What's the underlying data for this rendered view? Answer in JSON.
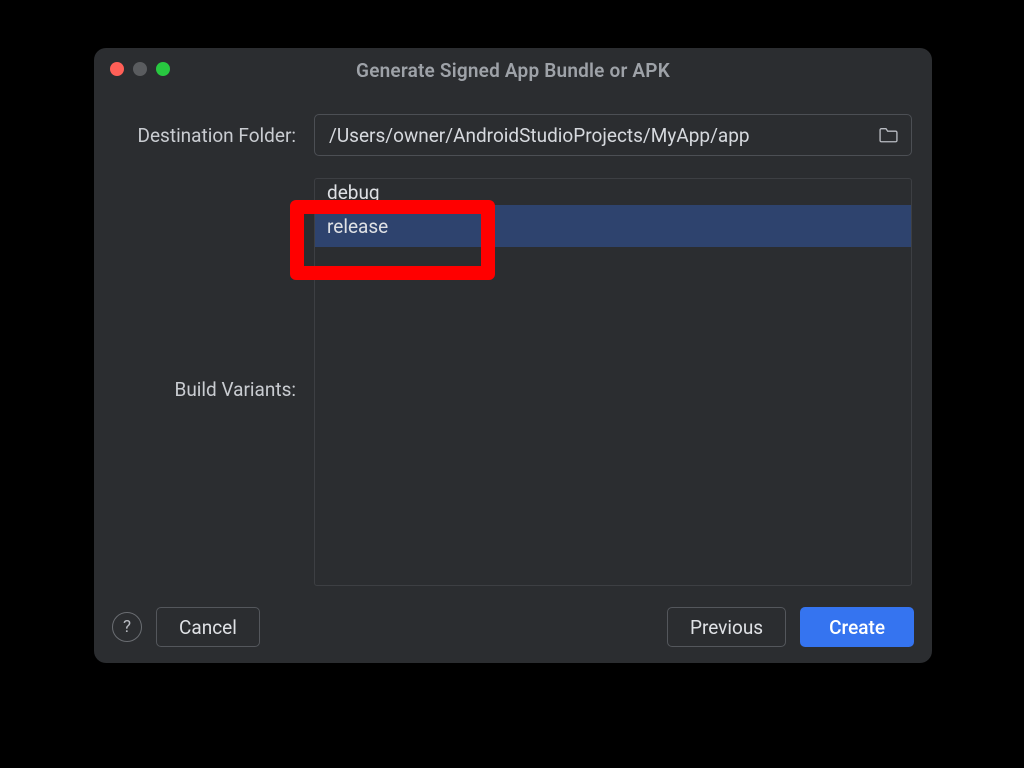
{
  "title": "Generate Signed App Bundle or APK",
  "labels": {
    "destination": "Destination Folder:",
    "variants": "Build Variants:"
  },
  "destination_path": "/Users/owner/AndroidStudioProjects/MyApp/app",
  "variants": {
    "items": [
      "debug",
      "release"
    ],
    "selected_index": 1
  },
  "buttons": {
    "help": "?",
    "cancel": "Cancel",
    "previous": "Previous",
    "create": "Create"
  },
  "annotation": {
    "highlight_target": "release"
  },
  "colors": {
    "dialog_bg": "#2b2d30",
    "selection_bg": "#2e436e",
    "primary": "#3574f0",
    "highlight": "#ff0000"
  }
}
